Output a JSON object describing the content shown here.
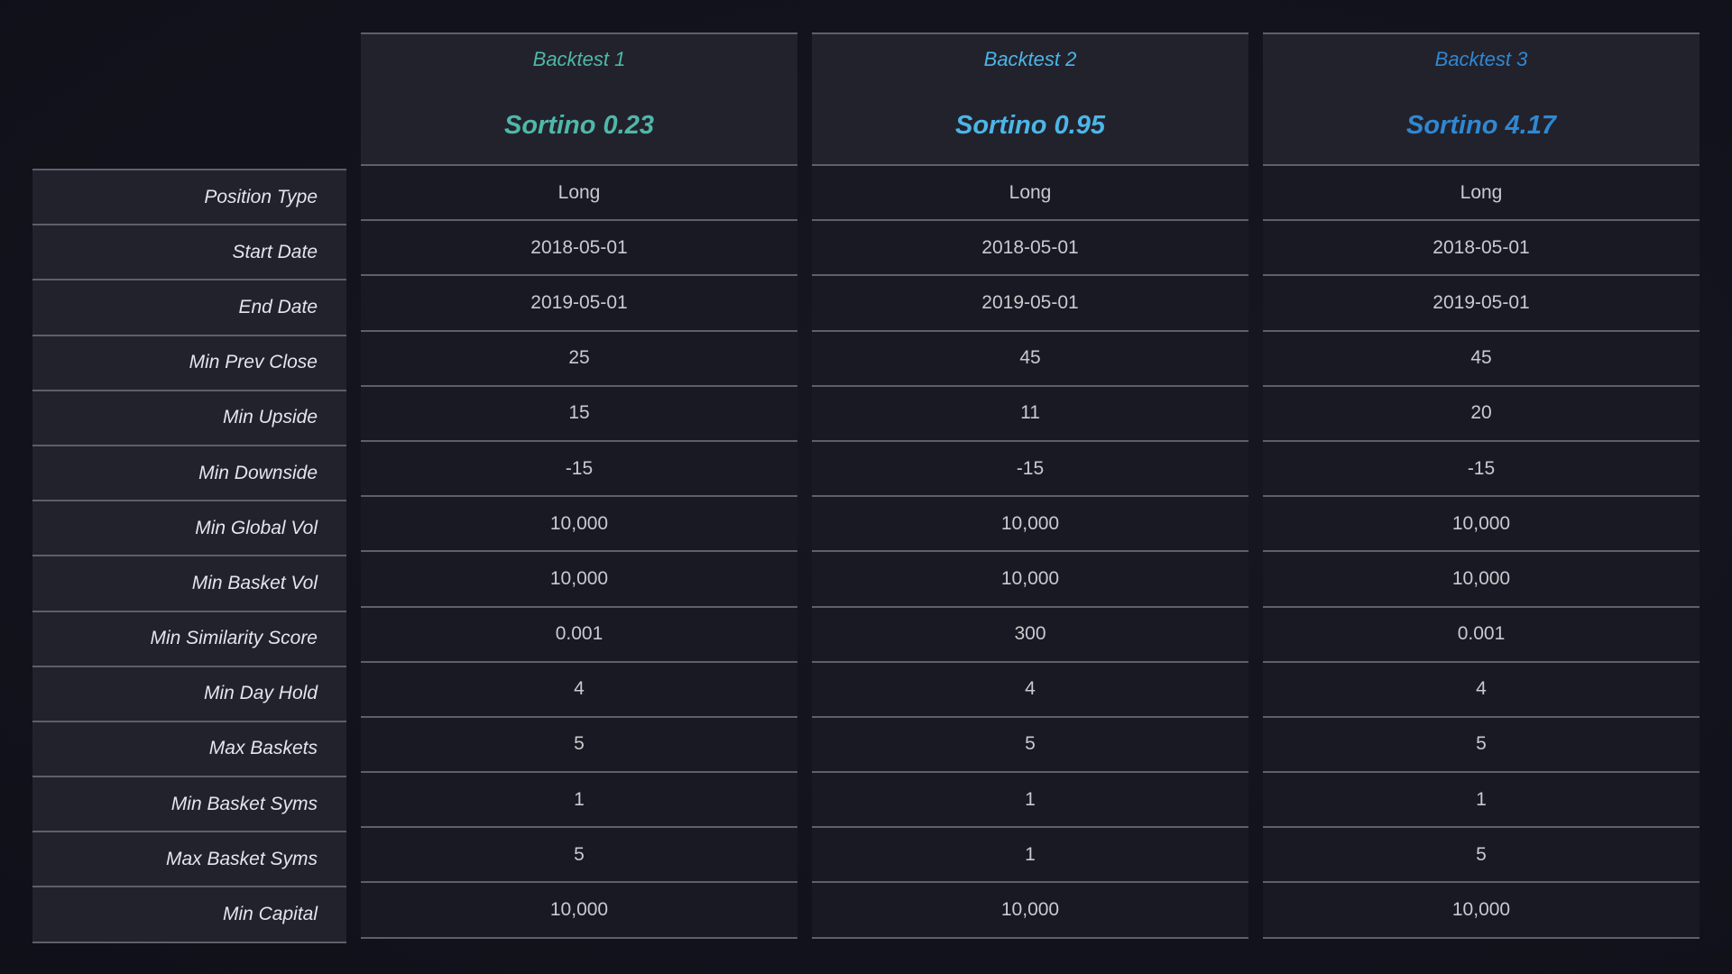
{
  "row_labels": [
    "Position Type",
    "Start Date",
    "End Date",
    "Min Prev Close",
    "Min Upside",
    "Min Downside",
    "Min Global Vol",
    "Min Basket Vol",
    "Min Similarity Score",
    "Min Day Hold",
    "Max Baskets",
    "Min Basket Syms",
    "Max Basket Syms",
    "Min Capital"
  ],
  "backtests": [
    {
      "title": "Backtest 1",
      "sortino": "Sortino 0.23",
      "color": "#4fb8a8",
      "values": [
        "Long",
        "2018-05-01",
        "2019-05-01",
        "25",
        "15",
        "-15",
        "10,000",
        "10,000",
        "0.001",
        "4",
        "5",
        "1",
        "5",
        "10,000"
      ]
    },
    {
      "title": "Backtest 2",
      "sortino": "Sortino 0.95",
      "color": "#4cb6e6",
      "values": [
        "Long",
        "2018-05-01",
        "2019-05-01",
        "45",
        "11",
        "-15",
        "10,000",
        "10,000",
        "300",
        "4",
        "5",
        "1",
        "1",
        "10,000"
      ]
    },
    {
      "title": "Backtest 3",
      "sortino": "Sortino 4.17",
      "color": "#2f88d2",
      "values": [
        "Long",
        "2018-05-01",
        "2019-05-01",
        "45",
        "20",
        "-15",
        "10,000",
        "10,000",
        "0.001",
        "4",
        "5",
        "1",
        "5",
        "10,000"
      ]
    }
  ]
}
